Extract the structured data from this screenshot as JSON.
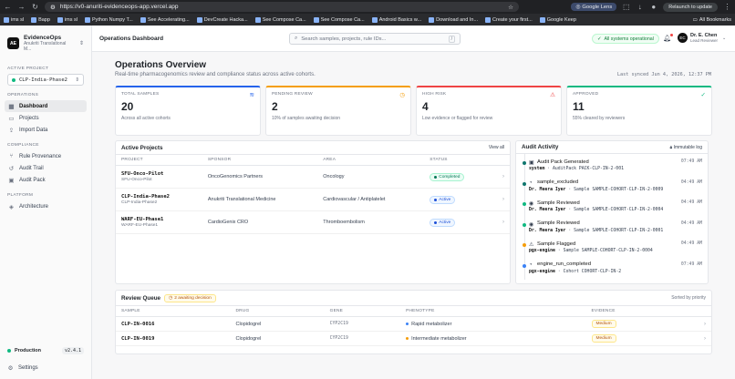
{
  "browser": {
    "url": "https://v0-anuriti-evidenceops-app.vercel.app",
    "lens_label": "Google Lens",
    "relaunch_label": "Relaunch to update",
    "bookmarks": [
      "ims sl",
      "Bapp",
      "ims sl",
      "Python Numpy T...",
      "See Accelerating...",
      "DevCreate Hacka...",
      "See Compose Ca...",
      "See Compose Ca...",
      "Android Basics w...",
      "Download and In...",
      "Create your first...",
      "Google Keep"
    ],
    "all_bookmarks": "All Bookmarks"
  },
  "sidebar": {
    "brand_title": "EvidenceOps",
    "brand_sub": "Anukriti Translational M...",
    "logo": "AE",
    "active_project_label": "ACTIVE PROJECT",
    "active_project": "CLP-India-Phase2",
    "sections": [
      {
        "label": "OPERATIONS",
        "items": [
          {
            "label": "Dashboard",
            "icon": "grid-icon",
            "active": true
          },
          {
            "label": "Projects",
            "icon": "folder-icon"
          },
          {
            "label": "Import Data",
            "icon": "upload-icon"
          }
        ]
      },
      {
        "label": "COMPLIANCE",
        "items": [
          {
            "label": "Rule Provenance",
            "icon": "branch-icon"
          },
          {
            "label": "Audit Trail",
            "icon": "history-icon"
          },
          {
            "label": "Audit Pack",
            "icon": "package-icon"
          }
        ]
      },
      {
        "label": "PLATFORM",
        "items": [
          {
            "label": "Architecture",
            "icon": "layers-icon"
          }
        ]
      }
    ],
    "env": "Production",
    "version": "v2.4.1",
    "settings": "Settings"
  },
  "topbar": {
    "title": "Operations Dashboard",
    "search_placeholder": "Search samples, projects, rule IDs...",
    "search_kbd": "/",
    "status": "All systems operational",
    "user_initials": "EC",
    "user_name": "Dr. E. Chen",
    "user_role": "Lead Reviewer"
  },
  "overview": {
    "title": "Operations Overview",
    "subtitle": "Real-time pharmacogenomics review and compliance status across active cohorts.",
    "synced": "Last synced Jun 4, 2026, 12:37 PM"
  },
  "kpis": [
    {
      "label": "TOTAL SAMPLES",
      "value": "20",
      "hint": "Across all active cohorts",
      "color": "#2563eb",
      "icon": "database-icon",
      "glyph": "≋"
    },
    {
      "label": "PENDING REVIEW",
      "value": "2",
      "hint": "10% of samples awaiting decision",
      "color": "#f59e0b",
      "icon": "clock-icon",
      "glyph": "◷"
    },
    {
      "label": "HIGH RISK",
      "value": "4",
      "hint": "Low evidence or flagged for review",
      "color": "#ef4444",
      "icon": "warning-icon",
      "glyph": "⚠"
    },
    {
      "label": "APPROVED",
      "value": "11",
      "hint": "55% cleared by reviewers",
      "color": "#10b981",
      "icon": "check-circle-icon",
      "glyph": "✓"
    }
  ],
  "projects": {
    "title": "Active Projects",
    "view_all": "View all",
    "columns": [
      "PROJECT",
      "SPONSOR",
      "AREA",
      "STATUS"
    ],
    "rows": [
      {
        "id": "SFU-Onco-Pilot",
        "sub": "SFU-Onco-Pilot",
        "sponsor": "OncoGenomics Partners",
        "area": "Oncology",
        "status": "Completed",
        "kind": "green"
      },
      {
        "id": "CLP-India-Phase2",
        "sub": "CLP-India-Phase2",
        "sponsor": "Anukriti Translational Medicine",
        "area": "Cardiovascular / Antiplatelet",
        "status": "Active",
        "kind": "blue"
      },
      {
        "id": "WARF-EU-Phase1",
        "sub": "WARF-EU-Phase1",
        "sponsor": "CardioGenix CRO",
        "area": "Thromboembolism",
        "status": "Active",
        "kind": "blue"
      }
    ]
  },
  "audit": {
    "title": "Audit Activity",
    "immutable": "Immutable log",
    "items": [
      {
        "title": "Audit Pack Generated",
        "actor": "system",
        "detail": "AuditPack PACK-CLP-IN-2-001",
        "time": "07:49 AM",
        "color": "#0f766e",
        "icon": "package-icon",
        "glyph": "▣"
      },
      {
        "title": "sample_excluded",
        "actor": "Dr. Meera Iyer",
        "detail": "Sample SAMPLE-COHORT-CLP-IN-2-0009",
        "time": "04:49 AM",
        "color": "#0f766e",
        "icon": "history-icon",
        "glyph": "◔"
      },
      {
        "title": "Sample Reviewed",
        "actor": "Dr. Meera Iyer",
        "detail": "Sample SAMPLE-COHORT-CLP-IN-2-0004",
        "time": "04:49 AM",
        "color": "#10b981",
        "icon": "check-icon",
        "glyph": "◉"
      },
      {
        "title": "Sample Reviewed",
        "actor": "Dr. Meera Iyer",
        "detail": "Sample SAMPLE-COHORT-CLP-IN-2-0001",
        "time": "04:49 AM",
        "color": "#10b981",
        "icon": "check-icon",
        "glyph": "◉"
      },
      {
        "title": "Sample Flagged",
        "actor": "pgx-engine",
        "detail": "Sample SAMPLE-COHORT-CLP-IN-2-0004",
        "time": "04:49 AM",
        "color": "#f59e0b",
        "icon": "warning-icon",
        "glyph": "⚠"
      },
      {
        "title": "engine_run_completed",
        "actor": "pgx-engine",
        "detail": "Cohort COHORT-CLP-IN-2",
        "time": "07:49 AM",
        "color": "#3b82f6",
        "icon": "history-icon",
        "glyph": "◔"
      }
    ]
  },
  "queue": {
    "title": "Review Queue",
    "badge": "2 awaiting decision",
    "sorted": "Sorted by priority",
    "columns": [
      "SAMPLE",
      "DRUG",
      "GENE",
      "PHENOTYPE",
      "EVIDENCE"
    ],
    "rows": [
      {
        "sample": "CLP-IN-0016",
        "drug": "Clopidogrel",
        "gene": "CYP2C19",
        "phenotype": "Rapid metabolizer",
        "pcolor": "#3b82f6",
        "evidence": "Medium"
      },
      {
        "sample": "CLP-IN-0019",
        "drug": "Clopidogrel",
        "gene": "CYP2C19",
        "phenotype": "Intermediate metabolizer",
        "pcolor": "#f59e0b",
        "evidence": "Medium"
      }
    ]
  }
}
